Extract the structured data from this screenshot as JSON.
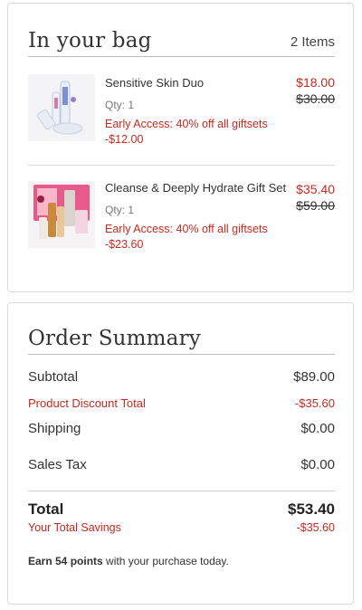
{
  "bag": {
    "title": "In your bag",
    "item_count": "2 Items",
    "items": [
      {
        "name": "Sensitive Skin Duo",
        "qty": "Qty: 1",
        "promo": "Early Access: 40% off all giftsets",
        "promo_amount": "-$12.00",
        "sale_price": "$18.00",
        "original_price": "$30.00"
      },
      {
        "name": "Cleanse & Deeply Hydrate Gift Set",
        "qty": "Qty: 1",
        "promo": "Early Access: 40% off all giftsets",
        "promo_amount": "-$23.60",
        "sale_price": "$35.40",
        "original_price": "$59.00"
      }
    ]
  },
  "summary": {
    "title": "Order Summary",
    "subtotal_label": "Subtotal",
    "subtotal_value": "$89.00",
    "discount_label": "Product Discount Total",
    "discount_value": "-$35.60",
    "shipping_label": "Shipping",
    "shipping_value": "$0.00",
    "tax_label": "Sales Tax",
    "tax_value": "$0.00",
    "total_label": "Total",
    "total_value": "$53.40",
    "savings_label": "Your Total Savings",
    "savings_value": "-$35.60",
    "points_prefix": "Earn 54 points",
    "points_suffix": " with your purchase today."
  },
  "colors": {
    "accent_red": "#c8281e",
    "border": "#d9d9d9",
    "text": "#333333"
  }
}
